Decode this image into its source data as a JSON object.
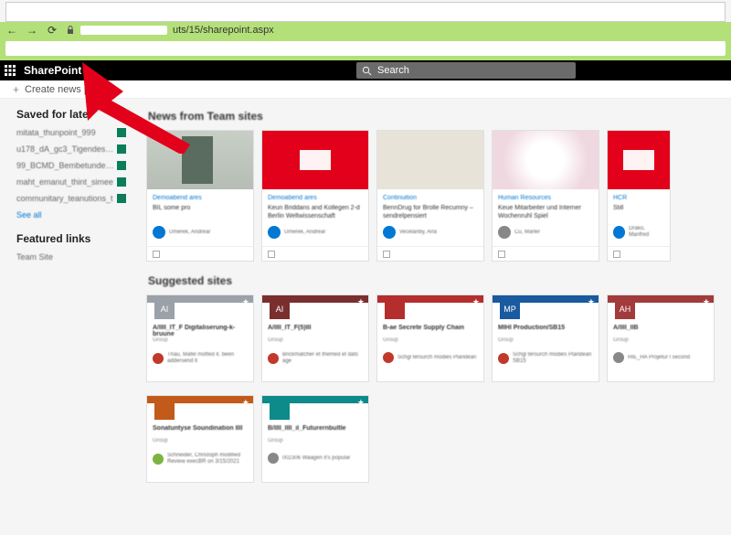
{
  "browser": {
    "url_suffix": "uts/15/sharepoint.aspx"
  },
  "header": {
    "app_name": "SharePoint",
    "search_placeholder": "Search"
  },
  "command": {
    "create_news": "Create news post"
  },
  "sidebar": {
    "saved_title": "Saved for later",
    "saved_items": [
      "mitata_thunpoint_999",
      "u178_dA_gc3_Tigendes_Inf",
      "99_BCMD_Bembetunde_fg",
      "maht_emanut_thint_simee",
      "communitary_teanutions_t"
    ],
    "see_all": "See all",
    "featured_title": "Featured links",
    "featured_items": [
      "Team Site"
    ]
  },
  "sections": {
    "news_title": "News from Team sites",
    "suggested_title": "Suggested sites"
  },
  "news": [
    {
      "site": "Demoabend ares",
      "title": "BIL some pro",
      "author": "Umerek, Andrear",
      "img": "door",
      "avatar": "#0078d4"
    },
    {
      "site": "Demoabend ares",
      "title": "Keun Briddans and Kollegen 2-d Berlin Weltwissenschaft",
      "author": "Umerek, Andrear",
      "img": "red",
      "avatar": "#0078d4"
    },
    {
      "site": "Continuition",
      "title": "BennDrug for Brolle Recumny – sendrelpensiert",
      "author": "Vecelanby, Arla",
      "img": "conf",
      "avatar": "#0078d4"
    },
    {
      "site": "Human Resources",
      "title": "Keue Mitarbeiter und Interner Wochenruhl Spiel",
      "author": "Cu, Marler",
      "img": "flower",
      "avatar": "#888"
    },
    {
      "site": "HCR",
      "title": "Still",
      "author": "Drako, Manfred",
      "img": "red",
      "avatar": "#0078d4"
    }
  ],
  "sites": [
    {
      "title": "A/IIII_IT_F Digitaliserung-k-bruune",
      "sub": "Group",
      "bar": "#9aa1a8",
      "tile": "#9aa1a8",
      "init": "AI",
      "dot": "#c0392b",
      "act": "Thau, Mafel mofted it. been addersend it"
    },
    {
      "title": "A/IIII_IT_F(5)III",
      "sub": "Group",
      "bar": "#7a2e2e",
      "tile": "#7a2e2e",
      "init": "AI",
      "dot": "#c0392b",
      "act": "Brickmatcher et themed et dats age"
    },
    {
      "title": "B-ae Secrete Supply Chain",
      "sub": "Group",
      "bar": "#b52e2e",
      "tile": "#b52e2e",
      "init": "",
      "dot": "#c0392b",
      "act": "Schgl tersurch modies Plandean"
    },
    {
      "title": "MIHI Production/SB15",
      "sub": "Group",
      "bar": "#1a5a9e",
      "tile": "#1a5a9e",
      "init": "MP",
      "dot": "#c0392b",
      "act": "Schgl tersurch modies Plandean SB15"
    },
    {
      "title": "A/IIII_IIB",
      "sub": "Group",
      "bar": "#a23b3b",
      "tile": "#a23b3b",
      "init": "AH",
      "dot": "#888",
      "act": "HIE_HA Projetur l second"
    },
    {
      "title": "Sonatuntyse Soundination IIII",
      "sub": "Group",
      "bar": "#c25a1a",
      "tile": "#c25a1a",
      "init": "",
      "dot": "#7cb342",
      "act": "Schneider, Christoph modified Review execBR on 3/15/2021"
    },
    {
      "title": "B/IIII_IIII_il_Futurernbultle",
      "sub": "Group",
      "bar": "#0d8a8a",
      "tile": "#0d8a8a",
      "init": "",
      "dot": "#888",
      "act": "002306 Waagen it's popular"
    }
  ]
}
